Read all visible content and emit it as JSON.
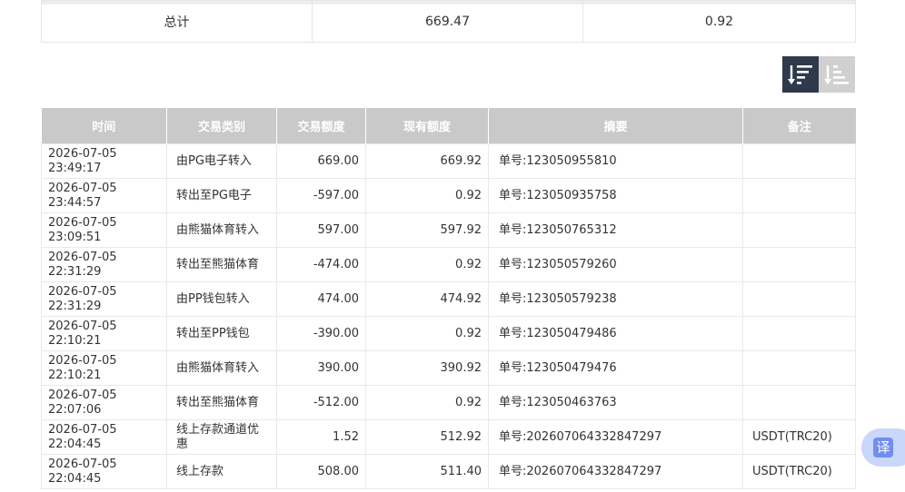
{
  "summary": {
    "label": "总计",
    "amount": "669.47",
    "balance": "0.92"
  },
  "sort": {
    "desc_icon": "sort-descending-icon",
    "asc_icon": "sort-ascending-icon"
  },
  "table": {
    "headers": [
      "时间",
      "交易类别",
      "交易额度",
      "现有额度",
      "摘要",
      "备注"
    ],
    "rows": [
      {
        "time": "2026-07-05 23:49:17",
        "category": "由PG电子转入",
        "amount": "669.00",
        "balance": "669.92",
        "memo": "单号:123050955810",
        "note": ""
      },
      {
        "time": "2026-07-05 23:44:57",
        "category": "转出至PG电子",
        "amount": "-597.00",
        "balance": "0.92",
        "memo": "单号:123050935758",
        "note": ""
      },
      {
        "time": "2026-07-05 23:09:51",
        "category": "由熊猫体育转入",
        "amount": "597.00",
        "balance": "597.92",
        "memo": "单号:123050765312",
        "note": ""
      },
      {
        "time": "2026-07-05 22:31:29",
        "category": "转出至熊猫体育",
        "amount": "-474.00",
        "balance": "0.92",
        "memo": "单号:123050579260",
        "note": ""
      },
      {
        "time": "2026-07-05 22:31:29",
        "category": "由PP钱包转入",
        "amount": "474.00",
        "balance": "474.92",
        "memo": "单号:123050579238",
        "note": ""
      },
      {
        "time": "2026-07-05 22:10:21",
        "category": "转出至PP钱包",
        "amount": "-390.00",
        "balance": "0.92",
        "memo": "单号:123050479486",
        "note": ""
      },
      {
        "time": "2026-07-05 22:10:21",
        "category": "由熊猫体育转入",
        "amount": "390.00",
        "balance": "390.92",
        "memo": "单号:123050479476",
        "note": ""
      },
      {
        "time": "2026-07-05 22:07:06",
        "category": "转出至熊猫体育",
        "amount": "-512.00",
        "balance": "0.92",
        "memo": "单号:123050463763",
        "note": ""
      },
      {
        "time": "2026-07-05 22:04:45",
        "category": "线上存款通道优惠",
        "amount": "1.52",
        "balance": "512.92",
        "memo": "单号:202607064332847297",
        "note": "USDT(TRC20)"
      },
      {
        "time": "2026-07-05 22:04:45",
        "category": "线上存款",
        "amount": "508.00",
        "balance": "511.40",
        "memo": "单号:202607064332847297",
        "note": "USDT(TRC20)"
      }
    ]
  },
  "translate": {
    "label": "译",
    "icon": "translate-icon"
  }
}
